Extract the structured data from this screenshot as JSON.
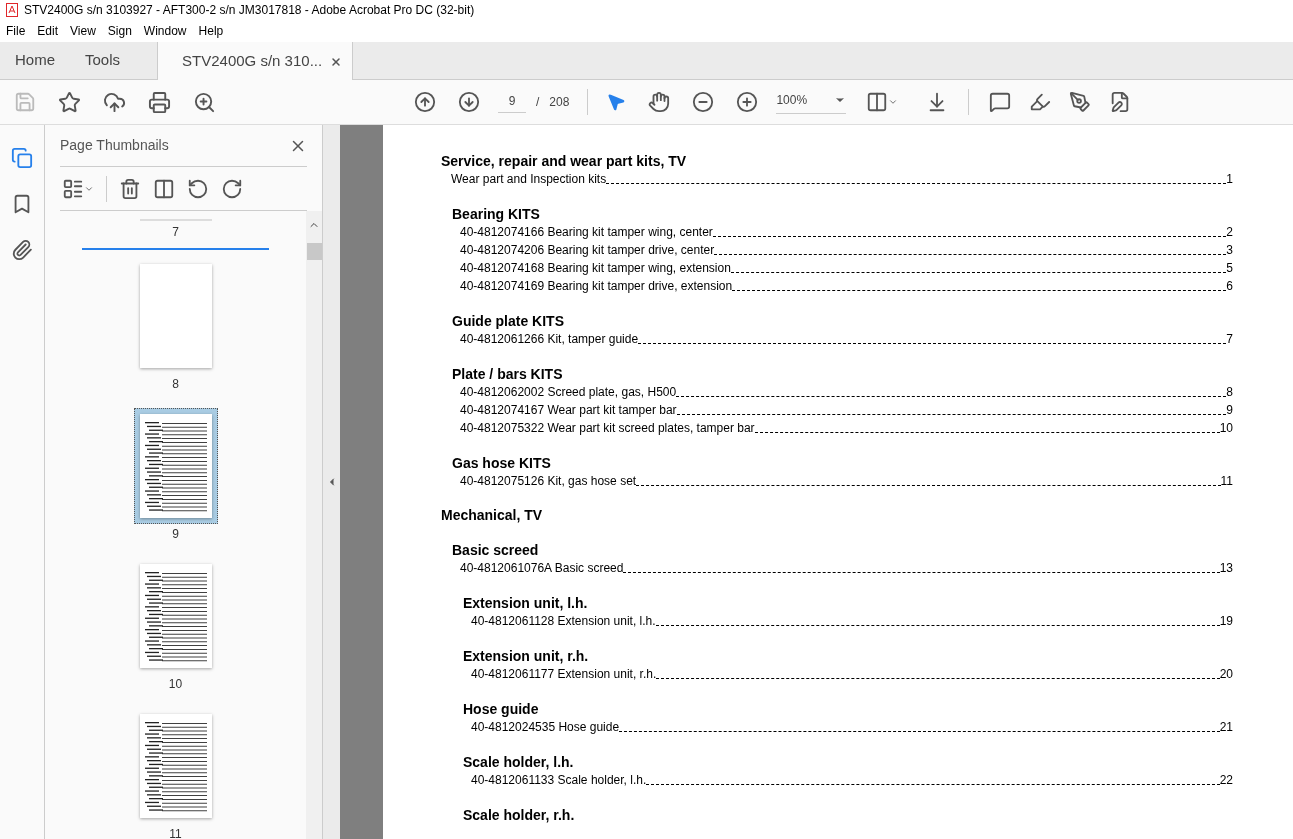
{
  "window": {
    "title": "STV2400G s/n 3103927 - AFT300-2 s/n JM3017818 - Adobe Acrobat Pro DC (32-bit)"
  },
  "menu": [
    "File",
    "Edit",
    "View",
    "Sign",
    "Window",
    "Help"
  ],
  "tabs": [
    {
      "label": "Home",
      "kind": "nav",
      "selected": false
    },
    {
      "label": "Tools",
      "kind": "nav",
      "selected": false
    },
    {
      "label": "STV2400G s/n 310...",
      "kind": "document",
      "selected": true
    }
  ],
  "toolbar": {
    "page": "9",
    "separator": "/",
    "total": "208",
    "zoom": "100%"
  },
  "panel": {
    "title": "Page Thumbnails",
    "thumbnails": [
      {
        "label": "7",
        "kind": "cut",
        "selected": false
      },
      {
        "label": "8",
        "kind": "blank",
        "selected": false
      },
      {
        "label": "9",
        "kind": "text",
        "selected": true
      },
      {
        "label": "10",
        "kind": "text",
        "selected": false
      },
      {
        "label": "11",
        "kind": "text",
        "selected": false
      }
    ]
  },
  "document": {
    "toc": [
      {
        "kind": "heading",
        "text": "Service, repair and wear part kits, TV",
        "children": [
          {
            "kind": "entry",
            "text": "Wear part and Inspection kits",
            "page": "1"
          },
          {
            "kind": "heading",
            "text": "Bearing KITS",
            "children": [
              {
                "kind": "entry",
                "text": "40-4812074166 Bearing kit tamper wing, center",
                "page": "2"
              },
              {
                "kind": "entry",
                "text": "40-4812074206 Bearing kit tamper drive, center",
                "page": "3"
              },
              {
                "kind": "entry",
                "text": "40-4812074168 Bearing kit tamper wing, extension",
                "page": "5"
              },
              {
                "kind": "entry",
                "text": "40-4812074169 Bearing kit tamper drive, extension",
                "page": "6"
              }
            ]
          },
          {
            "kind": "heading",
            "text": "Guide plate KITS",
            "children": [
              {
                "kind": "entry",
                "text": "40-4812061266 Kit, tamper guide",
                "page": "7"
              }
            ]
          },
          {
            "kind": "heading",
            "text": "Plate / bars KITS",
            "children": [
              {
                "kind": "entry",
                "text": "40-4812062002 Screed plate, gas, H500",
                "page": "8"
              },
              {
                "kind": "entry",
                "text": "40-4812074167 Wear part kit tamper bar",
                "page": "9"
              },
              {
                "kind": "entry",
                "text": "40-4812075322 Wear part kit screed plates, tamper bar",
                "page": "10"
              }
            ]
          },
          {
            "kind": "heading",
            "text": "Gas hose KITS",
            "children": [
              {
                "kind": "entry",
                "text": "40-4812075126 Kit, gas hose set",
                "page": "11"
              }
            ]
          }
        ]
      },
      {
        "kind": "heading",
        "text": "Mechanical, TV",
        "children": [
          {
            "kind": "heading",
            "text": "Basic screed",
            "children": [
              {
                "kind": "entry",
                "text": "40-4812061076A Basic screed",
                "page": "13"
              },
              {
                "kind": "heading",
                "text": "Extension unit, l.h.",
                "children": [
                  {
                    "kind": "entry",
                    "text": "40-4812061128 Extension unit, l.h.",
                    "page": "19"
                  }
                ]
              },
              {
                "kind": "heading",
                "text": "Extension unit, r.h.",
                "children": [
                  {
                    "kind": "entry",
                    "text": "40-4812061177 Extension unit, r.h.",
                    "page": "20"
                  }
                ]
              },
              {
                "kind": "heading",
                "text": "Hose guide",
                "children": [
                  {
                    "kind": "entry",
                    "text": "40-4812024535 Hose guide",
                    "page": "21"
                  }
                ]
              },
              {
                "kind": "heading",
                "text": "Scale holder, l.h.",
                "children": [
                  {
                    "kind": "entry",
                    "text": "40-4812061133 Scale holder, l.h.",
                    "page": "22"
                  }
                ]
              },
              {
                "kind": "heading",
                "text": "Scale holder, r.h."
              }
            ]
          }
        ]
      }
    ]
  }
}
